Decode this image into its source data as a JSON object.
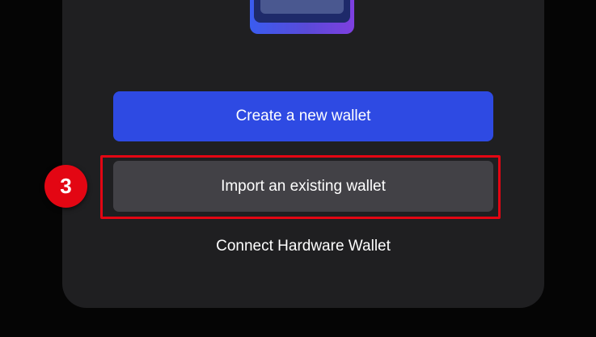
{
  "onboarding": {
    "create_label": "Create a new wallet",
    "import_label": "Import an existing wallet",
    "hardware_label": "Connect Hardware Wallet"
  },
  "annotation": {
    "step_number": "3"
  },
  "colors": {
    "background": "#050505",
    "card": "#1f1f21",
    "primary_button": "#2e4ae3",
    "secondary_button": "#424146",
    "highlight": "#e30613",
    "text": "#ffffff"
  }
}
